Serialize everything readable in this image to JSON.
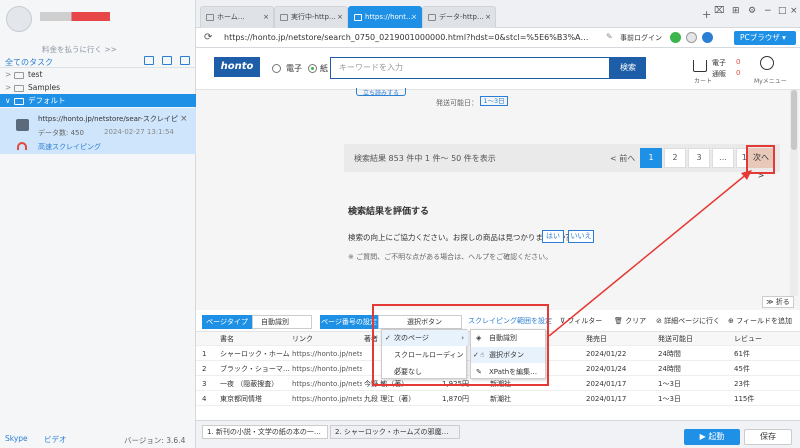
{
  "left": {
    "upgrade": "料金を払うに行く >>",
    "tasks_title": "全てのタスク",
    "tree": [
      {
        "label": "test",
        "arrow": ">"
      },
      {
        "label": "Samples",
        "arrow": ">"
      },
      {
        "label": "デフォルト",
        "arrow": "∨"
      }
    ],
    "task": {
      "url": "https://honto.jp/netstore/sear-スクレイピン…",
      "count_label": "データ数: 450",
      "date": "2024-02-27 13:1:54",
      "speed": "高速スクレイピング"
    },
    "footer": {
      "skype": "Skype",
      "video": "ビデオ",
      "version": "バージョン: 3.6.4"
    }
  },
  "browser": {
    "tabs": [
      "ホーム…",
      "実行中-http…",
      "https://hont…",
      "データ-http…"
    ],
    "url": "https://honto.jp/netstore/search_0750_0219001000000.html?hdst=0&stcl=%5E6%B3%A…",
    "one_click_login": "事前ログイン",
    "pc_browser": "PCブラウザ"
  },
  "honto": {
    "logo": "honto",
    "radio_ebook": "電子",
    "radio_paper": "紙",
    "keyword_placeholder": "キーワードを入力",
    "search_button": "検索",
    "cart_label": "カート",
    "cart_ebook": "電子",
    "cart_paper": "通販",
    "cart_ebook_count": "0",
    "cart_paper_count": "0",
    "my_menu": "Myメニュー"
  },
  "page": {
    "btn_stub": "立ち読みする",
    "ship_date_label": "発送可能日：",
    "ship_date_value": "1〜3日",
    "results_text": "検索結果 853 件中 1 件〜 50 件を表示",
    "prev": "< 前へ",
    "pages": [
      "1",
      "2",
      "3",
      "…",
      "18"
    ],
    "next": "次へ >",
    "eval_title": "検索結果を評価する",
    "eval_question": "検索の向上にご協力ください。お探しの商品は見つかりましたか？",
    "yes": "はい",
    "no": "いいえ",
    "note": "※ ご質問、ご不明な点がある場合は、ヘルプをご確認ください。",
    "fold": "≫ 折る"
  },
  "toolbar": {
    "page_type": "ページタイプ",
    "page_type_value": "自動識別",
    "page_number": "ページ番号の設定",
    "page_number_value": "選択ボタン",
    "scroll_range": "スクレイピング範囲を設定",
    "filter": "フィルター",
    "clear": "クリア",
    "detail": "詳細ページに行く",
    "add_field": "フィールドを追加"
  },
  "table": {
    "headers": [
      "",
      "書名",
      "リンク",
      "著者",
      "",
      "",
      "発売日",
      "発送可能日",
      "レビュー"
    ],
    "rows": [
      [
        "1",
        "シャーロック・ホーム…",
        "https://honto.jp/netst…",
        "",
        "",
        "",
        "2024/01/22",
        "24時間",
        "61件"
      ],
      [
        "2",
        "ブラック・ショーマ…",
        "https://honto.jp/netst…",
        "",
        "",
        "",
        "2024/01/24",
        "24時間",
        "45件"
      ],
      [
        "3",
        "一夜 （隠蔽捜査）",
        "https://honto.jp/netst…",
        "今野 敏（著）",
        "1,925円",
        "新潮社",
        "2024/01/17",
        "1〜3日",
        "23件"
      ],
      [
        "4",
        "東京都同情塔",
        "https://honto.jp/netst…",
        "九段 理江（著）",
        "1,870円",
        "新潮社",
        "2024/01/17",
        "1〜3日",
        "115件"
      ]
    ]
  },
  "dropdown": {
    "items": [
      "次のページ",
      "スクロールローディング",
      "必要なし"
    ],
    "sub_items": [
      "自動識別",
      "選択ボタン",
      "XPathを編集…"
    ]
  },
  "bottom": {
    "tabs": [
      "1. 新刊の小説・文学の紙の本の一…",
      "2. シャーロック・ホームズの邪魔…"
    ],
    "start": "▶ 起動",
    "save": "保存"
  }
}
